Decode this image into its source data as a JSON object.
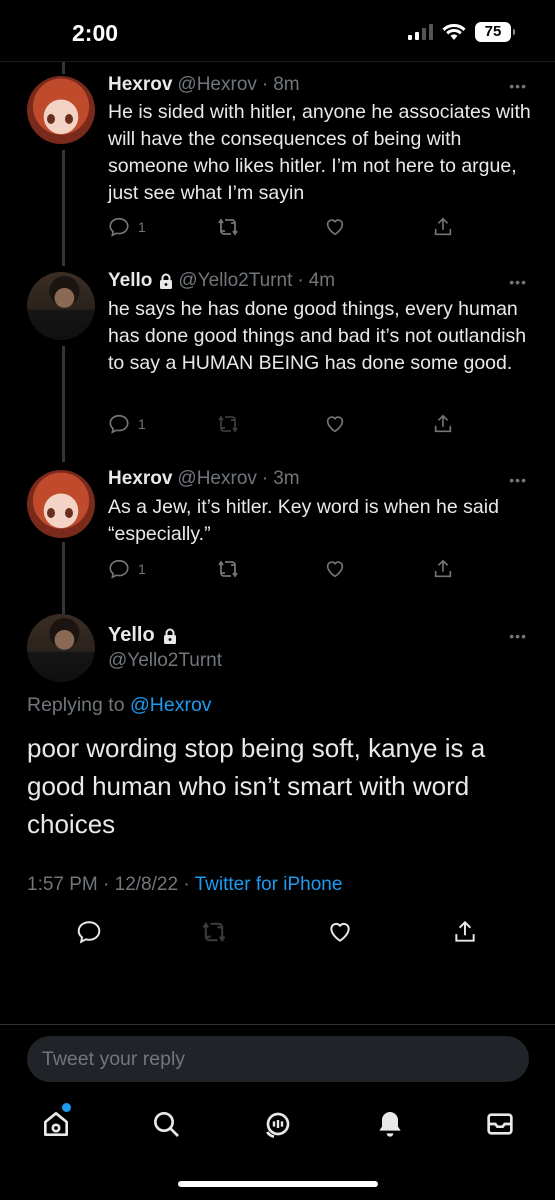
{
  "status_bar": {
    "time": "2:00",
    "battery": "75"
  },
  "thread": [
    {
      "name": "Hexrov",
      "handle": "@Hexrov",
      "time": "8m",
      "text": "He is sided with hitler, anyone he associates with will have the consequences of being with someone who likes hitler. I’m not here to argue, just see what I’m sayin",
      "reply_count": "1",
      "verified_lock": false,
      "avatar": "anime-avatar"
    },
    {
      "name": "Yello",
      "handle": "@Yello2Turnt",
      "time": "4m",
      "text": "he says he has done good things, every human has done good things and bad it’s not outlandish to say a HUMAN BEING has done some good.",
      "reply_count": "1",
      "verified_lock": true,
      "avatar": "photo-avatar"
    },
    {
      "name": "Hexrov",
      "handle": "@Hexrov",
      "time": "3m",
      "text": "As a Jew, it’s hitler. Key word is when he said “especially.”",
      "reply_count": "1",
      "verified_lock": false,
      "avatar": "anime-avatar"
    }
  ],
  "focused": {
    "name": "Yello",
    "handle": "@Yello2Turnt",
    "replying_prefix": "Replying to",
    "replying_to": "@Hexrov",
    "text": "poor wording stop being soft, kanye is a good human who isn’t smart with word choices",
    "timestamp": "1:57 PM · 12/8/22 ·",
    "source": "Twitter for iPhone"
  },
  "reply": {
    "placeholder": "Tweet your reply"
  },
  "meta_separator": "·",
  "colors": {
    "accent": "#1d9bf0",
    "muted": "#71767b",
    "background": "#000000"
  },
  "icons": [
    "reply-icon",
    "retweet-icon",
    "like-icon",
    "share-icon",
    "home-icon",
    "search-icon",
    "spaces-icon",
    "notifications-icon",
    "messages-icon"
  ]
}
